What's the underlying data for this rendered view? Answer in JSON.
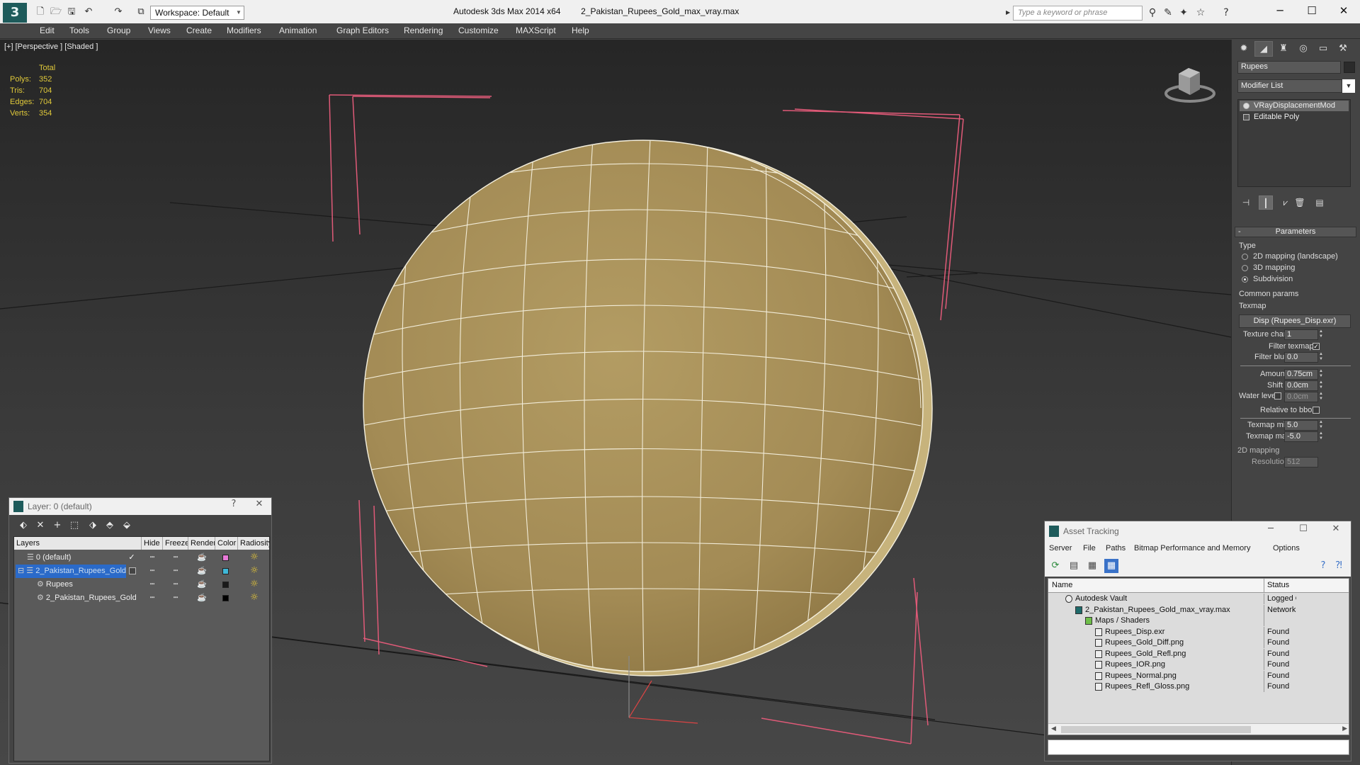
{
  "titlebar": {
    "workspace": "Workspace: Default",
    "title_app": "Autodesk 3ds Max  2014 x64",
    "title_file": "2_Pakistan_Rupees_Gold_max_vray.max",
    "search_placeholder": "Type a keyword or phrase",
    "win_minimize": "─",
    "win_maximize": "☐",
    "win_close": "✕"
  },
  "menu": [
    "Edit",
    "Tools",
    "Group",
    "Views",
    "Create",
    "Modifiers",
    "Animation",
    "Graph Editors",
    "Rendering",
    "Customize",
    "MAXScript",
    "Help"
  ],
  "viewport": {
    "label": "[+] [Perspective ] [Shaded ]",
    "stats_header": "Total",
    "stats": [
      {
        "label": "Polys:",
        "value": "352"
      },
      {
        "label": "Tris:",
        "value": "704"
      },
      {
        "label": "Edges:",
        "value": "704"
      },
      {
        "label": "Verts:",
        "value": "354"
      }
    ]
  },
  "command_panel": {
    "object_name": "Rupees",
    "modifier_list": "Modifier List",
    "stack": [
      "VRayDisplacementMod",
      "Editable Poly"
    ],
    "params_title": "Parameters",
    "type_label": "Type",
    "type_options": [
      "2D mapping (landscape)",
      "3D mapping",
      "Subdivision"
    ],
    "type_selected": "Subdivision",
    "common_label": "Common params",
    "texmap_label": "Texmap",
    "texmap_value": "Disp (Rupees_Disp.exr)",
    "texture_chan_label": "Texture chan",
    "texture_chan": "1",
    "filter_texmap_label": "Filter texmap",
    "filter_blur_label": "Filter blur",
    "filter_blur": "0.0",
    "amount_label": "Amount",
    "amount": "0.75cm",
    "shift_label": "Shift",
    "shift": "0.0cm",
    "water_level_label": "Water level",
    "water_level": "0.0cm",
    "relative_bbox_label": "Relative to bbox",
    "texmap_min_label": "Texmap min",
    "texmap_min": "5.0",
    "texmap_max_label": "Texmap max",
    "texmap_max": "-5.0",
    "mapping_2d_label": "2D mapping",
    "resolution_label": "Resolution",
    "resolution": "512"
  },
  "layer_panel": {
    "title": "Layer: 0 (default)",
    "help": "?",
    "close": "✕",
    "columns": [
      "Layers",
      "Hide",
      "Freeze",
      "Render",
      "Color",
      "Radiosity"
    ],
    "rows": [
      {
        "name": "0 (default)",
        "color": "#e879d8",
        "selected": false,
        "indent": 0
      },
      {
        "name": "2_Pakistan_Rupees_Gold",
        "color": "#3fb8d8",
        "selected": true,
        "indent": 0
      },
      {
        "name": "Rupees",
        "color": "#1a1a1a",
        "selected": false,
        "indent": 1
      },
      {
        "name": "2_Pakistan_Rupees_Gold",
        "color": "#000000",
        "selected": false,
        "indent": 1
      }
    ]
  },
  "asset_panel": {
    "title": "Asset Tracking",
    "minimize": "─",
    "maximize": "☐",
    "close": "✕",
    "menu": [
      "Server",
      "File",
      "Paths",
      "Bitmap Performance and Memory",
      "Options"
    ],
    "columns": [
      "Name",
      "Status"
    ],
    "rows": [
      {
        "name": "Autodesk Vault",
        "status": "Logged O",
        "indent": 1
      },
      {
        "name": "2_Pakistan_Rupees_Gold_max_vray.max",
        "status": "Network",
        "indent": 2
      },
      {
        "name": "Maps / Shaders",
        "status": "",
        "indent": 3
      },
      {
        "name": "Rupees_Disp.exr",
        "status": "Found",
        "indent": 4
      },
      {
        "name": "Rupees_Gold_Diff.png",
        "status": "Found",
        "indent": 4
      },
      {
        "name": "Rupees_Gold_Refl.png",
        "status": "Found",
        "indent": 4
      },
      {
        "name": "Rupees_IOR.png",
        "status": "Found",
        "indent": 4
      },
      {
        "name": "Rupees_Normal.png",
        "status": "Found",
        "indent": 4
      },
      {
        "name": "Rupees_Refl_Gloss.png",
        "status": "Found",
        "indent": 4
      }
    ]
  },
  "colors": {
    "accent_selection": "#2a6ac9",
    "stats_text": "#e0c93a",
    "bbox_brackets": "#e05a78",
    "coin": "#a8925a"
  }
}
